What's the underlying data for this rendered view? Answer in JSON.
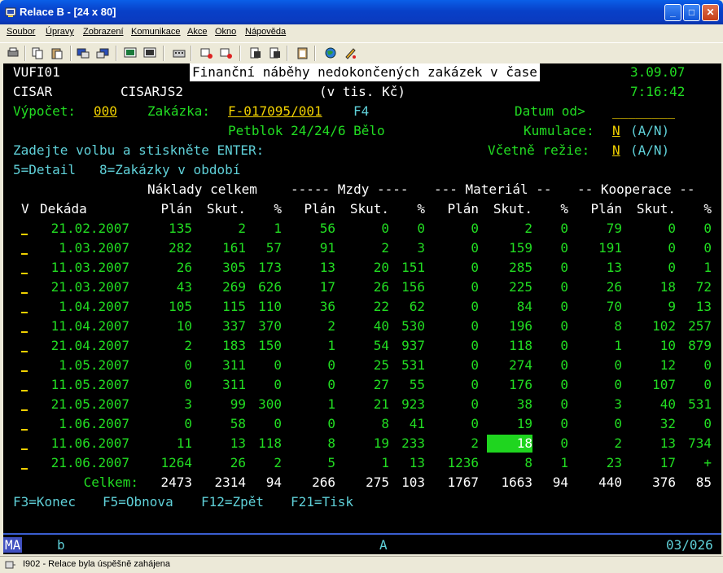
{
  "window": {
    "title": "Relace B - [24 x 80]"
  },
  "menu": [
    "Soubor",
    "Úpravy",
    "Zobrazení",
    "Komunikace",
    "Akce",
    "Okno",
    "Nápověda"
  ],
  "toolbar": [
    "print-icon",
    "copy-icon",
    "paste-icon",
    "send-icon",
    "receive-icon",
    "display-icon",
    "macro-icon",
    "keyboard-icon",
    "record-icon",
    "playback-icon",
    "stop-icon",
    "clipboard-icon",
    "transfer-up-icon",
    "transfer-down-icon",
    "globe-icon",
    "help-icon"
  ],
  "screen": {
    "program": "VUFI01",
    "screen_title": "Finanční náběhy nedokončených zakázek v čase",
    "date": "3.09.07",
    "user": "CISAR",
    "job": "CISARJS2",
    "unit": "(v tis. Kč)",
    "time": "7:16:42",
    "vypocet_label": "Výpočet:",
    "vypocet_value": "000",
    "zakazka_label": "Zakázka:",
    "zakazka_value": "F-017095/001",
    "zakazka_key": "F4",
    "datum_label": "Datum od>",
    "datum_value": "________",
    "customer": "Petblok 24/24/6 Bělo",
    "kumulace_label": "Kumulace:",
    "kumulace_value": "N",
    "kumulace_hint": "(A/N)",
    "rezie_label": "Včetně režie:",
    "rezie_value": "N",
    "rezie_hint": "(A/N)",
    "instruction": "Zadejte volbu a stiskněte ENTER:",
    "options": "5=Detail   8=Zakázky v období",
    "group_headers": {
      "naklady": "Náklady celkem",
      "mzdy": "----- Mzdy ----",
      "material": "--- Materiál --",
      "kooperace": "-- Kooperace --"
    },
    "col_headers": [
      "V",
      "Dekáda",
      "Plán",
      "Skut.",
      "%",
      "Plán",
      "Skut.",
      "%",
      "Plán",
      "Skut.",
      "%",
      "Plán",
      "Skut.",
      "%"
    ],
    "rows": [
      [
        "21.02.2007",
        "135",
        "2",
        "1",
        "56",
        "0",
        "0",
        "0",
        "2",
        "0",
        "79",
        "0",
        "0"
      ],
      [
        "1.03.2007",
        "282",
        "161",
        "57",
        "91",
        "2",
        "3",
        "0",
        "159",
        "0",
        "191",
        "0",
        "0"
      ],
      [
        "11.03.2007",
        "26",
        "305",
        "173",
        "13",
        "20",
        "151",
        "0",
        "285",
        "0",
        "13",
        "0",
        "1"
      ],
      [
        "21.03.2007",
        "43",
        "269",
        "626",
        "17",
        "26",
        "156",
        "0",
        "225",
        "0",
        "26",
        "18",
        "72"
      ],
      [
        "1.04.2007",
        "105",
        "115",
        "110",
        "36",
        "22",
        "62",
        "0",
        "84",
        "0",
        "70",
        "9",
        "13"
      ],
      [
        "11.04.2007",
        "10",
        "337",
        "370",
        "2",
        "40",
        "530",
        "0",
        "196",
        "0",
        "8",
        "102",
        "257"
      ],
      [
        "21.04.2007",
        "2",
        "183",
        "150",
        "1",
        "54",
        "937",
        "0",
        "118",
        "0",
        "1",
        "10",
        "879"
      ],
      [
        "1.05.2007",
        "0",
        "311",
        "0",
        "0",
        "25",
        "531",
        "0",
        "274",
        "0",
        "0",
        "12",
        "0"
      ],
      [
        "11.05.2007",
        "0",
        "311",
        "0",
        "0",
        "27",
        "55",
        "0",
        "176",
        "0",
        "0",
        "107",
        "0"
      ],
      [
        "21.05.2007",
        "3",
        "99",
        "300",
        "1",
        "21",
        "923",
        "0",
        "38",
        "0",
        "3",
        "40",
        "531"
      ],
      [
        "1.06.2007",
        "0",
        "58",
        "0",
        "0",
        "8",
        "41",
        "0",
        "19",
        "0",
        "0",
        "32",
        "0"
      ],
      [
        "11.06.2007",
        "11",
        "13",
        "118",
        "8",
        "19",
        "233",
        "2",
        "18",
        "0",
        "2",
        "13",
        "734"
      ],
      [
        "21.06.2007",
        "1264",
        "26",
        "2",
        "5",
        "1",
        "13",
        "1236",
        "8",
        "1",
        "23",
        "17",
        "+"
      ]
    ],
    "totals_label": "Celkem:",
    "totals": [
      "2473",
      "2314",
      "94",
      "266",
      "275",
      "103",
      "1767",
      "1663",
      "94",
      "440",
      "376",
      "85"
    ],
    "fkeys": [
      "F3=Konec",
      "F5=Obnova",
      "F12=Zpět",
      "F21=Tisk"
    ]
  },
  "oia": {
    "mode": "MA",
    "indicator_b": "b",
    "indicator_a": "A",
    "cursor_pos": "03/026"
  },
  "status": {
    "text": "I902 - Relace byla úspěšně zahájena"
  }
}
